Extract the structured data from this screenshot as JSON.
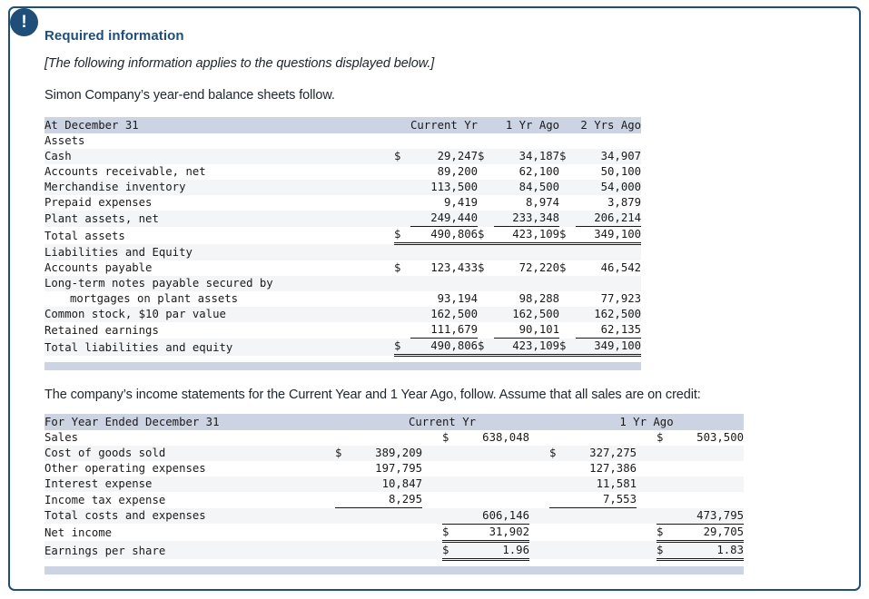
{
  "panel": {
    "alert_icon": "exclamation-icon",
    "alert_symbol": "!"
  },
  "header": {
    "title": "Required information",
    "note": "[The following information applies to the questions displayed below.]",
    "intro_balance": "Simon Company’s year-end balance sheets follow.",
    "intro_income": "The company’s income statements for the Current Year and 1 Year Ago, follow. Assume that all sales are on credit:"
  },
  "balance_sheet": {
    "row_label": "At December 31",
    "columns": [
      "Current Yr",
      "1 Yr Ago",
      "2 Yrs Ago"
    ],
    "assets_heading": "Assets",
    "assets": [
      {
        "label": "Cash",
        "cur": [
          "$",
          "$",
          "$"
        ],
        "values": [
          "29,247",
          "34,187",
          "34,907"
        ]
      },
      {
        "label": "Accounts receivable, net",
        "cur": [
          "",
          "",
          ""
        ],
        "values": [
          "89,200",
          "62,100",
          "50,100"
        ]
      },
      {
        "label": "Merchandise inventory",
        "cur": [
          "",
          "",
          ""
        ],
        "values": [
          "113,500",
          "84,500",
          "54,000"
        ]
      },
      {
        "label": "Prepaid expenses",
        "cur": [
          "",
          "",
          ""
        ],
        "values": [
          "9,419",
          "8,974",
          "3,879"
        ]
      },
      {
        "label": "Plant assets, net",
        "cur": [
          "",
          "",
          ""
        ],
        "values": [
          "249,440",
          "233,348",
          "206,214"
        ]
      }
    ],
    "total_assets": {
      "label": "Total assets",
      "cur": [
        "$",
        "$",
        "$"
      ],
      "values": [
        "490,806",
        "423,109",
        "349,100"
      ]
    },
    "liabilities_heading": "Liabilities and Equity",
    "liabilities": [
      {
        "label": "Accounts payable",
        "cur": [
          "$",
          "$",
          "$"
        ],
        "values": [
          "123,433",
          "72,220",
          "46,542"
        ]
      },
      {
        "label": "Long-term notes payable secured by",
        "cur": [
          "",
          "",
          ""
        ],
        "values": [
          "",
          "",
          ""
        ]
      },
      {
        "label": "mortgages on plant assets",
        "cur": [
          "",
          "",
          ""
        ],
        "values": [
          "93,194",
          "98,288",
          "77,923"
        ]
      },
      {
        "label": "Common stock, $10 par value",
        "cur": [
          "",
          "",
          ""
        ],
        "values": [
          "162,500",
          "162,500",
          "162,500"
        ]
      },
      {
        "label": "Retained earnings",
        "cur": [
          "",
          "",
          ""
        ],
        "values": [
          "111,679",
          "90,101",
          "62,135"
        ]
      }
    ],
    "total_liab_equity": {
      "label": "Total liabilities and equity",
      "cur": [
        "$",
        "$",
        "$"
      ],
      "values": [
        "490,806",
        "423,109",
        "349,100"
      ]
    }
  },
  "income_statement": {
    "row_label": "For Year Ended December 31",
    "columns": [
      "Current Yr",
      "1 Yr Ago"
    ],
    "rows": [
      {
        "label": "Sales",
        "cur_a": "",
        "val_a": "",
        "cur_b": "$",
        "val_b": "638,048",
        "cur_c": "",
        "val_c": "",
        "cur_d": "$",
        "val_d": "503,500"
      },
      {
        "label": "Cost of goods sold",
        "cur_a": "$",
        "val_a": "389,209",
        "cur_b": "",
        "val_b": "",
        "cur_c": "$",
        "val_c": "327,275",
        "cur_d": "",
        "val_d": ""
      },
      {
        "label": "Other operating expenses",
        "cur_a": "",
        "val_a": "197,795",
        "cur_b": "",
        "val_b": "",
        "cur_c": "",
        "val_c": "127,386",
        "cur_d": "",
        "val_d": ""
      },
      {
        "label": "Interest expense",
        "cur_a": "",
        "val_a": "10,847",
        "cur_b": "",
        "val_b": "",
        "cur_c": "",
        "val_c": "11,581",
        "cur_d": "",
        "val_d": ""
      },
      {
        "label": "Income tax expense",
        "cur_a": "",
        "val_a": "8,295",
        "cur_b": "",
        "val_b": "",
        "cur_c": "",
        "val_c": "7,553",
        "cur_d": "",
        "val_d": ""
      }
    ],
    "total_costs": {
      "label": "Total costs and expenses",
      "cur_b": "",
      "val_b": "606,146",
      "cur_d": "",
      "val_d": "473,795"
    },
    "net_income": {
      "label": "Net income",
      "cur_b": "$",
      "val_b": "31,902",
      "cur_d": "$",
      "val_d": "29,705"
    },
    "eps": {
      "label": "Earnings per share",
      "cur_b": "$",
      "val_b": "1.96",
      "cur_d": "$",
      "val_d": "1.83"
    }
  },
  "colors": {
    "accent": "#1f4e79",
    "header_fill": "#ccd3e2",
    "row_shade": "#f4f5f7",
    "text": "#1a1a1a"
  }
}
